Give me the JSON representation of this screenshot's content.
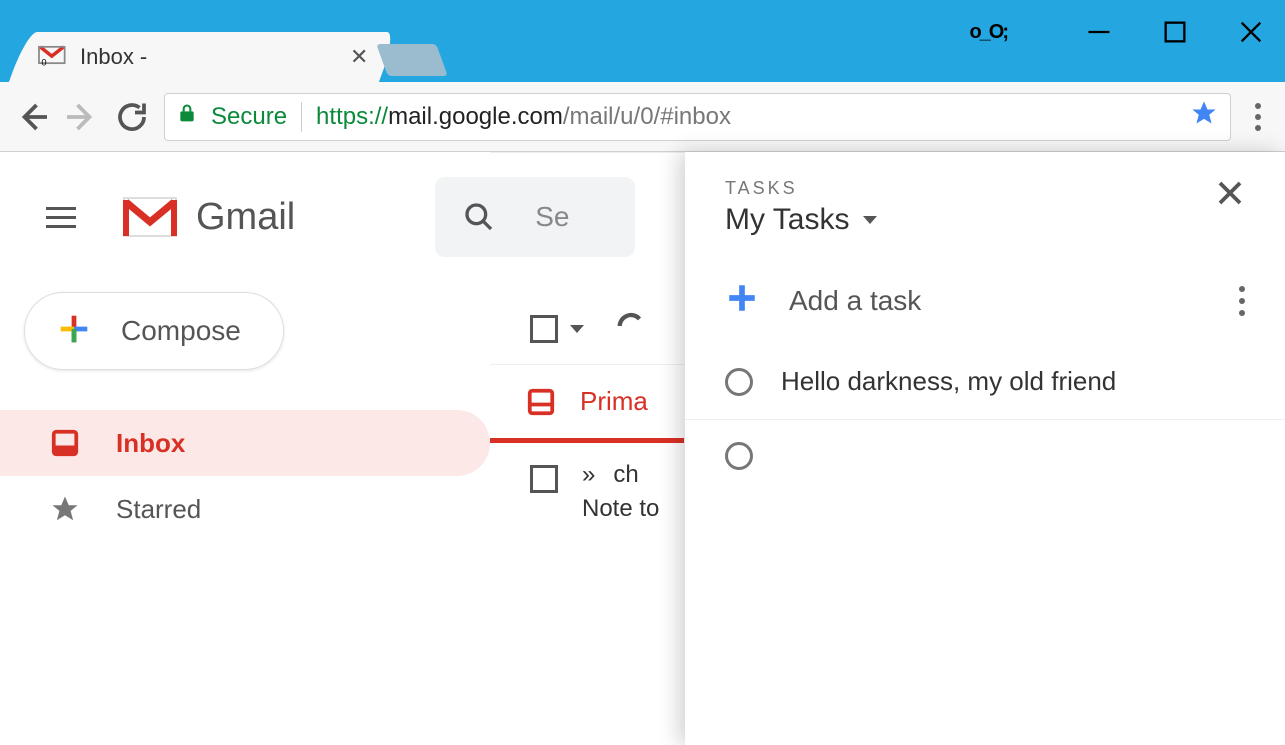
{
  "window": {
    "emoji": "o_O;"
  },
  "browser": {
    "tab_title": "Inbox -",
    "secure_label": "Secure",
    "url_protocol": "https://",
    "url_host": "mail.google.com",
    "url_path": "/mail/u/0/#inbox"
  },
  "gmail": {
    "brand": "Gmail",
    "search_placeholder": "Se",
    "compose": "Compose",
    "nav": {
      "inbox": "Inbox",
      "starred": "Starred"
    },
    "category_primary": "Prima",
    "mail": {
      "marker": "»",
      "sender": "ch",
      "snippet": "Note to"
    }
  },
  "tasks": {
    "eyebrow": "TASKS",
    "list_name": "My Tasks",
    "add_label": "Add a task",
    "items": [
      {
        "title": "Hello darkness, my old friend"
      },
      {
        "title": ""
      }
    ]
  }
}
